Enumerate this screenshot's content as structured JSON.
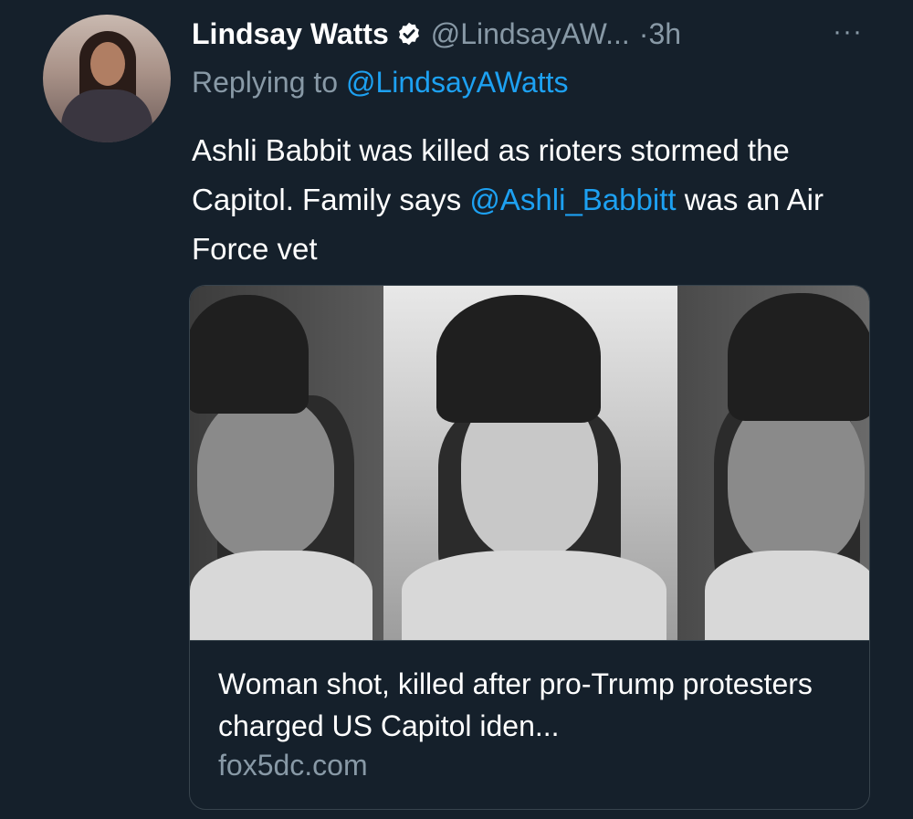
{
  "tweet": {
    "author_name": "Lindsay Watts",
    "author_handle": "@LindsayAW...",
    "separator_time": "·3h",
    "more": "···",
    "replying_prefix": "Replying to",
    "replying_handle": "@LindsayAWatts",
    "text_part1": "Ashli Babbit was killed as rioters stormed the Capitol. Family says",
    "mention": "@Ashli_Babbitt",
    "text_part2": "was an Air Force vet"
  },
  "card": {
    "title": "Woman shot, killed after pro-Trump protesters charged US Capitol iden...",
    "domain": "fox5dc.com"
  },
  "colors": {
    "background": "#15202b",
    "link": "#1da1f2",
    "secondary_text": "#8899a6",
    "border": "#38444d"
  },
  "icons": {
    "verified": "verified-badge-icon",
    "more": "more-options-icon"
  }
}
